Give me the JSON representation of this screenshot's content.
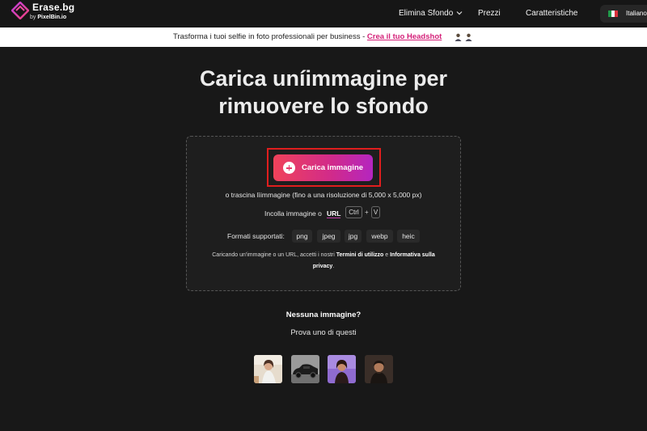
{
  "nav": {
    "logo_name": "Erase.bg",
    "logo_by": "by",
    "logo_brand": "PixelBin.io",
    "links": [
      "Elimina Sfondo",
      "Prezzi",
      "Caratteristiche"
    ],
    "language": "Italiano",
    "icons": [
      "erase-bg-logo",
      "chevron-down-icon",
      "italy-flag-icon"
    ]
  },
  "banner": {
    "text": "Trasforma i tuoi selfie in foto professionali per business - ",
    "link": "Crea il tuo Headshot",
    "icons": [
      "person-emoji-icon",
      "person-emoji-icon"
    ]
  },
  "headline": {
    "line1": "Carica uníimmagine per",
    "line2": "rimuovere lo sfondo"
  },
  "upload": {
    "button_label": "Carica immagine",
    "drag_text": "o trascina lìimmagine (fino a una risoluzione di 5,000 x 5,000 px)",
    "paste_text": "Incolla immagine o",
    "url_label": "URL",
    "key_ctrl": "Ctrl",
    "key_plus": "+",
    "key_v": "V",
    "formats_label": "Formati supportati:",
    "formats": [
      "png",
      "jpeg",
      "jpg",
      "webp",
      "heic"
    ],
    "terms_prefix": "Caricando un'immagine o un URL, accetti i nostri ",
    "terms_link1": "Termini di utilizzo",
    "terms_mid": " e ",
    "terms_link2": "Informativa sulla privacy",
    "terms_suffix": "."
  },
  "samples": {
    "title": "Nessuna immagine?",
    "subtitle": "Prova uno di questi",
    "items": [
      "woman-sample",
      "car-sample",
      "portrait-sample",
      "man-sample"
    ]
  },
  "colors": {
    "accent_start": "#f0425a",
    "accent_end": "#b426c0",
    "highlight_border": "#e01e1e",
    "link_pink": "#d41f78"
  }
}
